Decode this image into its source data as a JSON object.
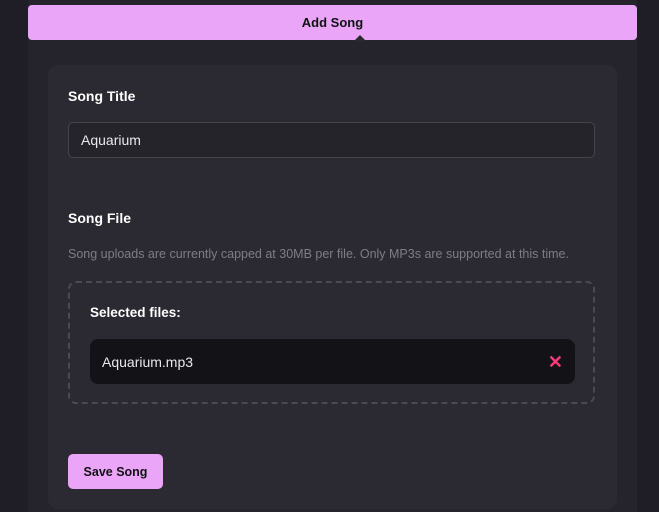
{
  "header": {
    "title": "Add Song"
  },
  "form": {
    "title_label": "Song Title",
    "title_value": "Aquarium",
    "file_label": "Song File",
    "file_hint": "Song uploads are currently capped at 30MB per file. Only MP3s are supported at this time.",
    "selected_label": "Selected files:",
    "files": [
      {
        "name": "Aquarium.mp3"
      }
    ],
    "remove_glyph": "✕",
    "save_label": "Save Song"
  },
  "colors": {
    "accent": "#eba5f8",
    "remove": "#ff3b7a",
    "card": "#2b2a32",
    "background": "#1f1e26"
  }
}
